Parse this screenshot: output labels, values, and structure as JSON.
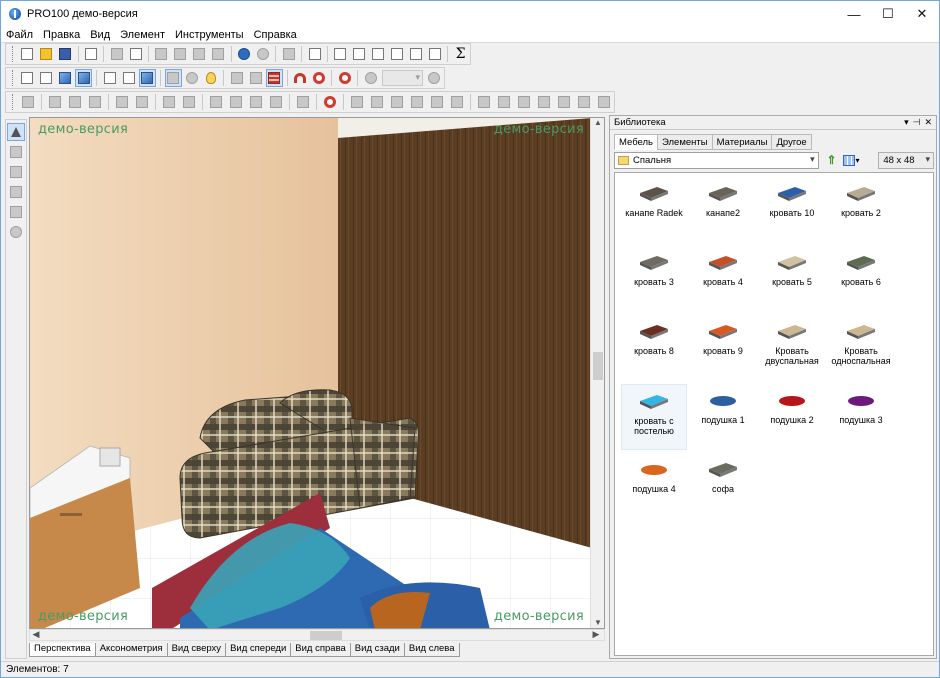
{
  "window": {
    "title": "PRO100 демо-версия",
    "controls": {
      "minimize": "—",
      "maximize": "☐",
      "close": "✕"
    }
  },
  "menu": [
    "Файл",
    "Правка",
    "Вид",
    "Элемент",
    "Инструменты",
    "Справка"
  ],
  "viewport": {
    "watermark": "демо-версия"
  },
  "view_tabs": [
    "Перспектива",
    "Аксонометрия",
    "Вид сверху",
    "Вид спереди",
    "Вид справа",
    "Вид сзади",
    "Вид слева"
  ],
  "status": {
    "elements": "Элементов: 7"
  },
  "library": {
    "title": "Библиотека",
    "header_buttons": [
      "▾",
      "⊣",
      "✕"
    ],
    "tabs": [
      "Мебель",
      "Элементы",
      "Материалы",
      "Другое"
    ],
    "folder": "Спальня",
    "icon_size": "48 x 48",
    "items": [
      {
        "label": "канапе Radek",
        "color": "#5c5448"
      },
      {
        "label": "канапе2",
        "color": "#6a6458"
      },
      {
        "label": "кровать 10",
        "color": "#2b5fa8"
      },
      {
        "label": "кровать 2",
        "color": "#b8ab96"
      },
      {
        "label": "кровать 3",
        "color": "#6f6a63"
      },
      {
        "label": "кровать 4",
        "color": "#c4502a"
      },
      {
        "label": "кровать 5",
        "color": "#d0c2a2"
      },
      {
        "label": "кровать 6",
        "color": "#5e6b51"
      },
      {
        "label": "кровать 8",
        "color": "#6a2e22"
      },
      {
        "label": "кровать 9",
        "color": "#d85a22"
      },
      {
        "label": "Кровать двуспальная",
        "color": "#cbb892"
      },
      {
        "label": "Кровать односпальная",
        "color": "#cbb892"
      },
      {
        "label": "кровать с постелью",
        "color": "#31b6e6"
      },
      {
        "label": "подушка 1",
        "color": "#2d5f9e"
      },
      {
        "label": "подушка 2",
        "color": "#b8141a"
      },
      {
        "label": "подушка 3",
        "color": "#6a1a7a"
      },
      {
        "label": "подушка 4",
        "color": "#d9651f"
      },
      {
        "label": "софа",
        "color": "#6b6b60"
      }
    ]
  }
}
